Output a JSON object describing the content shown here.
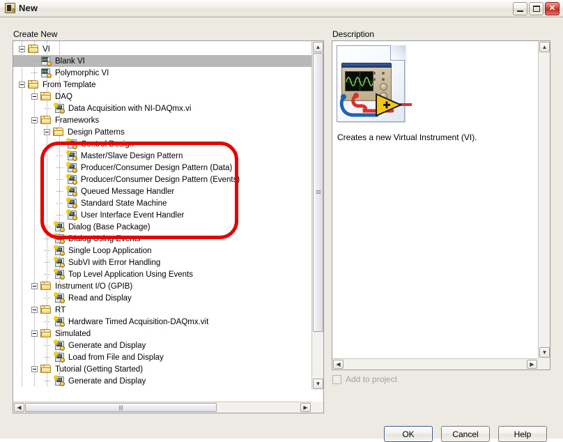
{
  "window": {
    "title": "New",
    "app_icon": "labview-vi-icon",
    "controls": {
      "minimize": "minimize-icon",
      "maximize": "maximize-icon",
      "close": "✕"
    }
  },
  "create_new": {
    "label": "Create New",
    "selected_item": "Blank VI",
    "tree": [
      {
        "depth": 0,
        "icon": "folder",
        "label": "VI",
        "expander": "minus"
      },
      {
        "depth": 1,
        "icon": "vi",
        "label": "Blank VI",
        "selected": true
      },
      {
        "depth": 1,
        "icon": "vi",
        "label": "Polymorphic VI"
      },
      {
        "depth": 0,
        "icon": "folder",
        "label": "From Template",
        "expander": "minus"
      },
      {
        "depth": 1,
        "icon": "folder",
        "label": "DAQ",
        "expander": "minus"
      },
      {
        "depth": 2,
        "icon": "template",
        "label": "Data Acquisition with NI-DAQmx.vi"
      },
      {
        "depth": 1,
        "icon": "folder",
        "label": "Frameworks",
        "expander": "minus"
      },
      {
        "depth": 2,
        "icon": "folder",
        "label": "Design Patterns",
        "expander": "minus"
      },
      {
        "depth": 3,
        "icon": "template",
        "label": "Control Design"
      },
      {
        "depth": 3,
        "icon": "template",
        "label": "Master/Slave Design Pattern"
      },
      {
        "depth": 3,
        "icon": "template",
        "label": "Producer/Consumer Design Pattern (Data)"
      },
      {
        "depth": 3,
        "icon": "template",
        "label": "Producer/Consumer Design Pattern (Events)"
      },
      {
        "depth": 3,
        "icon": "template",
        "label": "Queued Message Handler"
      },
      {
        "depth": 3,
        "icon": "template",
        "label": "Standard State Machine"
      },
      {
        "depth": 3,
        "icon": "template",
        "label": "User Interface Event Handler"
      },
      {
        "depth": 2,
        "icon": "template",
        "label": "Dialog (Base Package)"
      },
      {
        "depth": 2,
        "icon": "template",
        "label": "Dialog Using Events"
      },
      {
        "depth": 2,
        "icon": "template",
        "label": "Single Loop Application"
      },
      {
        "depth": 2,
        "icon": "template",
        "label": "SubVI with Error Handling"
      },
      {
        "depth": 2,
        "icon": "template",
        "label": "Top Level Application Using Events"
      },
      {
        "depth": 1,
        "icon": "folder",
        "label": "Instrument I/O (GPIB)",
        "expander": "minus"
      },
      {
        "depth": 2,
        "icon": "template",
        "label": "Read and Display"
      },
      {
        "depth": 1,
        "icon": "folder",
        "label": "RT",
        "expander": "minus"
      },
      {
        "depth": 2,
        "icon": "template",
        "label": "Hardware Timed Acquisition-DAQmx.vit"
      },
      {
        "depth": 1,
        "icon": "folder",
        "label": "Simulated",
        "expander": "minus"
      },
      {
        "depth": 2,
        "icon": "template",
        "label": "Generate and Display"
      },
      {
        "depth": 2,
        "icon": "template",
        "label": "Load from File and Display"
      },
      {
        "depth": 1,
        "icon": "folder",
        "label": "Tutorial (Getting Started)",
        "expander": "minus"
      },
      {
        "depth": 2,
        "icon": "template",
        "label": "Generate and Display"
      }
    ],
    "scrollbars": {
      "vertical_up": "▲",
      "vertical_down": "▼",
      "horizontal_left": "◀",
      "horizontal_right": "▶"
    }
  },
  "annotation": {
    "shape": "red-rounded-rectangle",
    "color": "#e60000",
    "encloses": "Design Patterns group"
  },
  "description": {
    "label": "Description",
    "image_alt": "vi-document-icon",
    "text": "Creates a new Virtual Instrument (VI).",
    "scrollbars": {
      "vertical_up": "▲",
      "vertical_down": "▼",
      "horizontal_left": "◀",
      "horizontal_right": "▶"
    }
  },
  "add_to_project": {
    "label": "Add to project",
    "checked": false,
    "enabled": false
  },
  "buttons": {
    "ok": "OK",
    "cancel": "Cancel",
    "help": "Help"
  }
}
